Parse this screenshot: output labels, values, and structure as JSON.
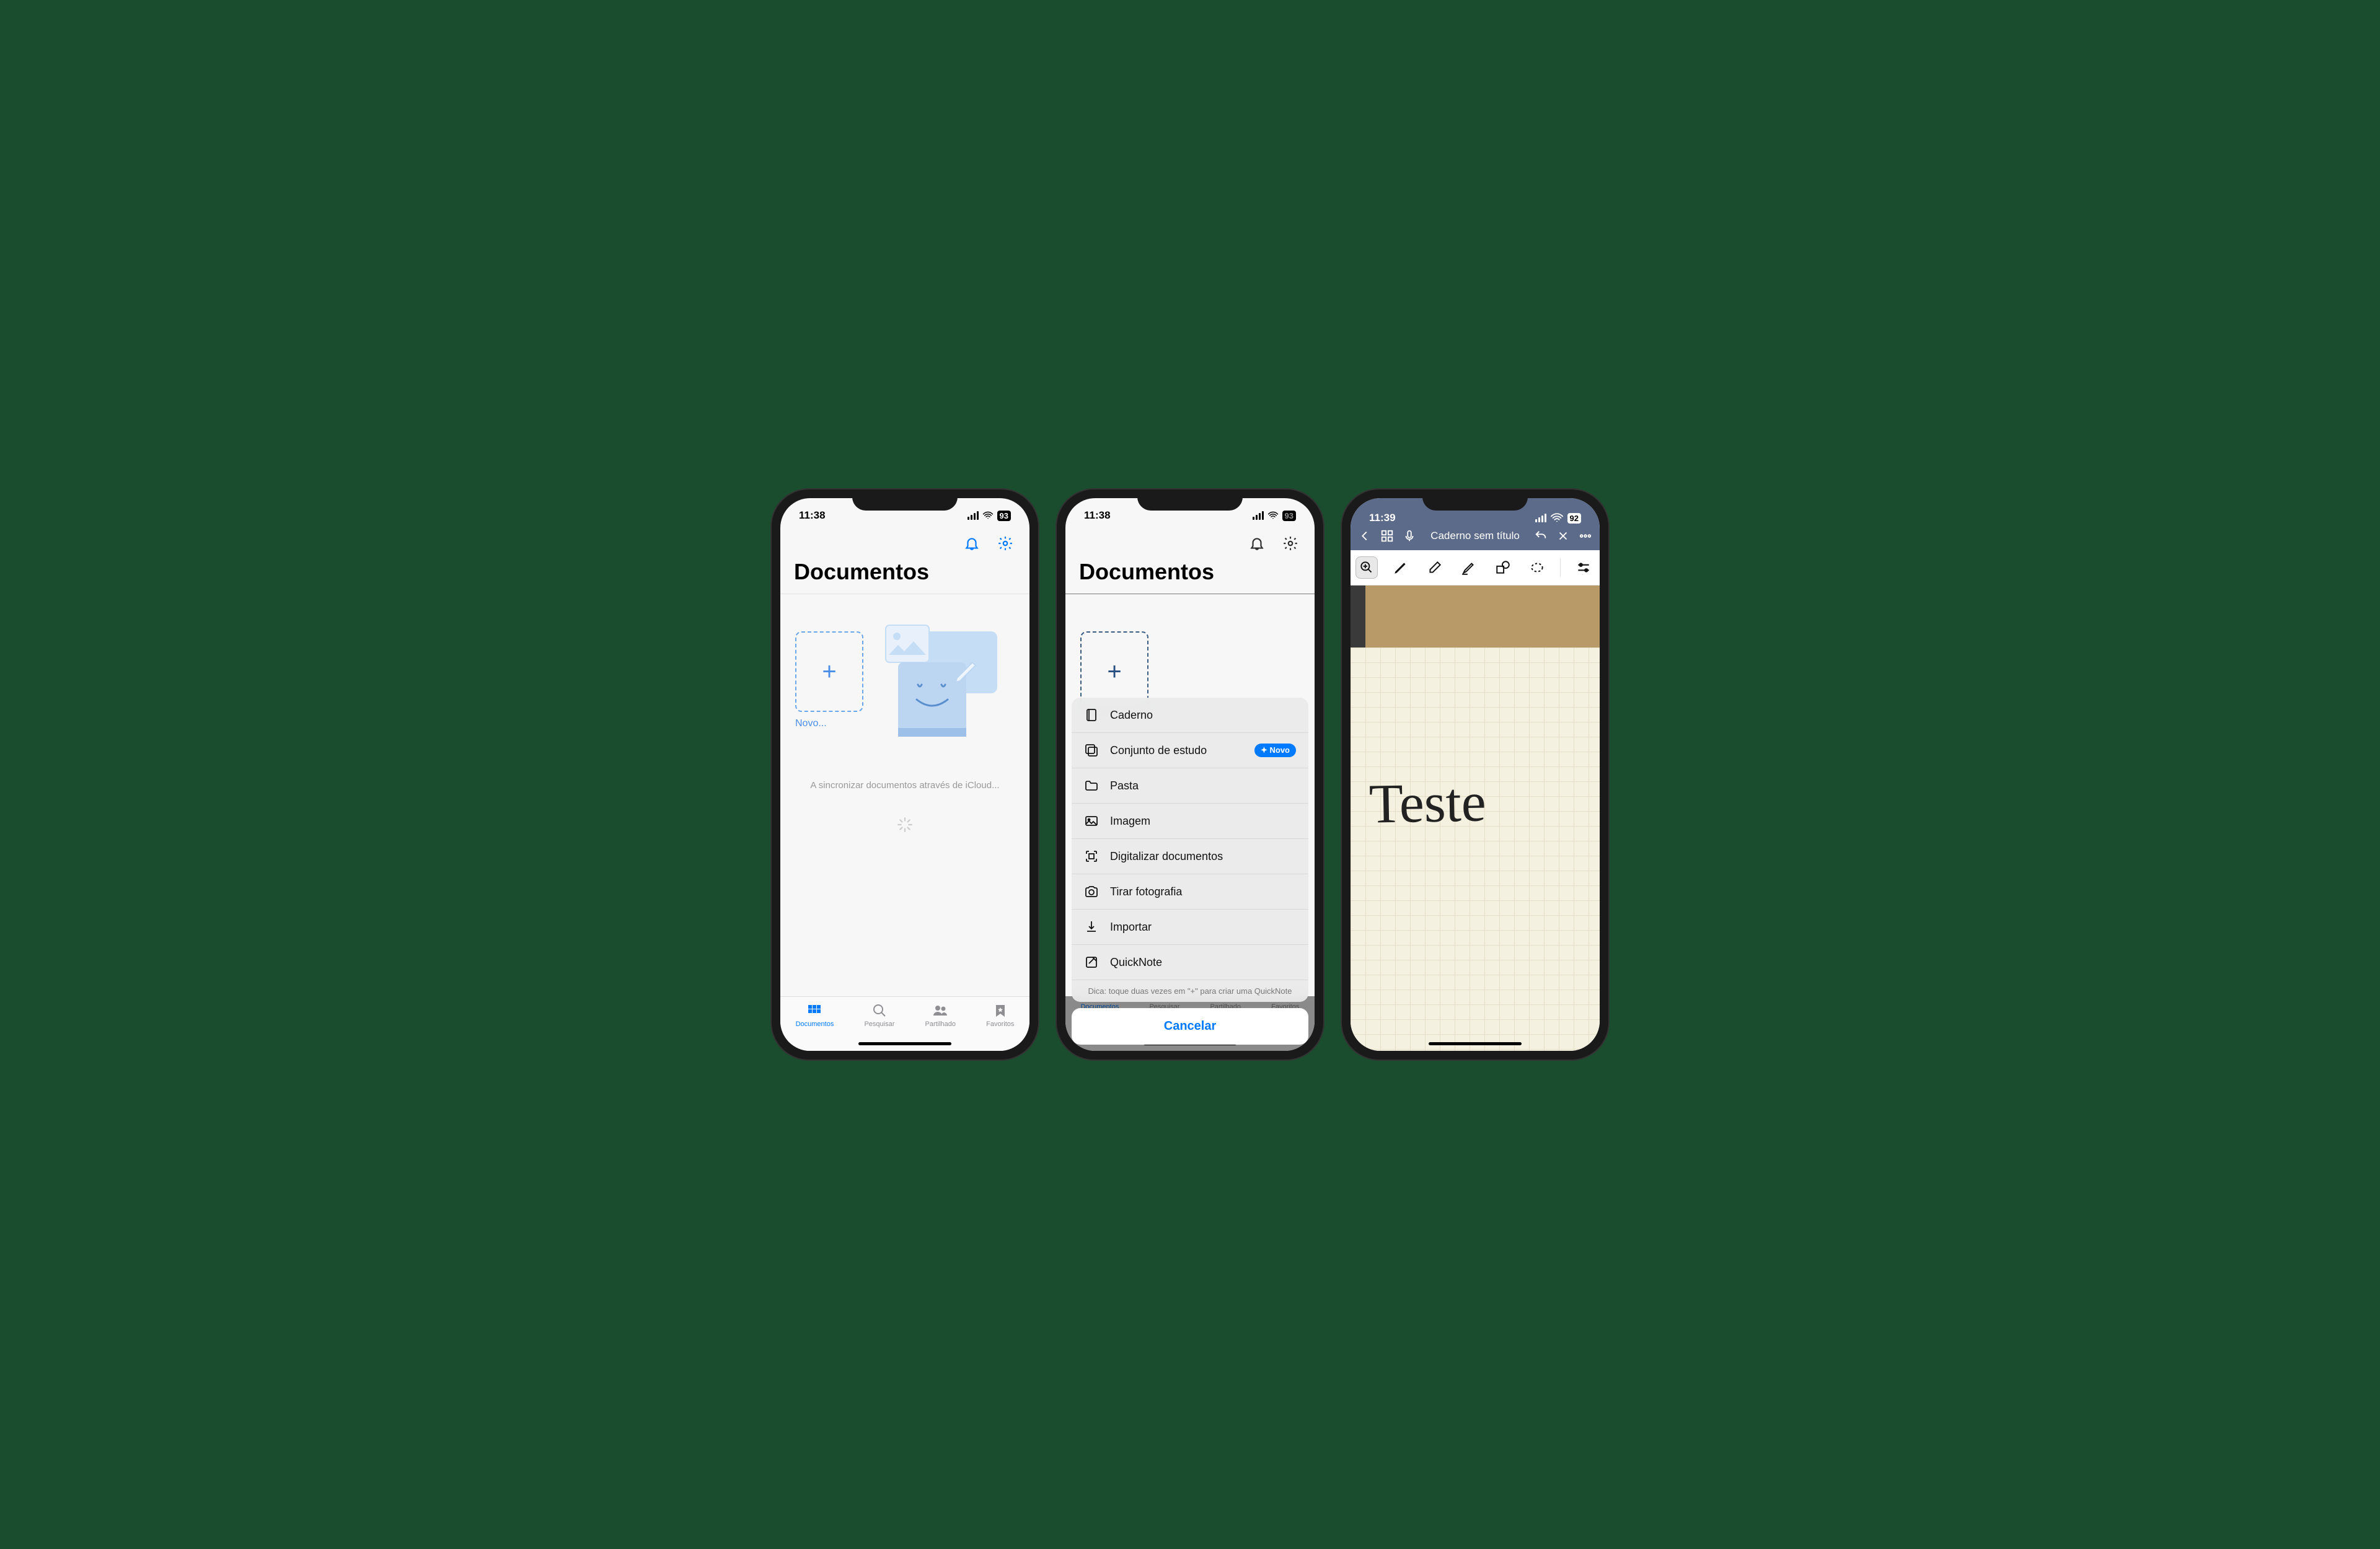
{
  "status": {
    "time1": "11:38",
    "time2": "11:38",
    "time3": "11:39",
    "battery1": "93",
    "battery2": "93",
    "battery3": "92"
  },
  "screen1": {
    "title": "Documentos",
    "new_label": "Novo...",
    "sync_text": "A sincronizar documentos através de iCloud...",
    "tabs": [
      {
        "label": "Documentos"
      },
      {
        "label": "Pesquisar"
      },
      {
        "label": "Partilhado"
      },
      {
        "label": "Favoritos"
      }
    ]
  },
  "screen2": {
    "title": "Documentos",
    "menu": [
      {
        "label": "Caderno",
        "icon": "notebook"
      },
      {
        "label": "Conjunto de estudo",
        "icon": "cards",
        "badge": "Novo"
      },
      {
        "label": "Pasta",
        "icon": "folder"
      },
      {
        "label": "Imagem",
        "icon": "image"
      },
      {
        "label": "Digitalizar documentos",
        "icon": "scan"
      },
      {
        "label": "Tirar fotografia",
        "icon": "camera"
      },
      {
        "label": "Importar",
        "icon": "import"
      },
      {
        "label": "QuickNote",
        "icon": "quicknote"
      }
    ],
    "hint": "Dica: toque duas vezes em \"+\" para criar uma QuickNote",
    "cancel": "Cancelar"
  },
  "screen3": {
    "title": "Caderno sem título",
    "handwriting": "Teste"
  }
}
